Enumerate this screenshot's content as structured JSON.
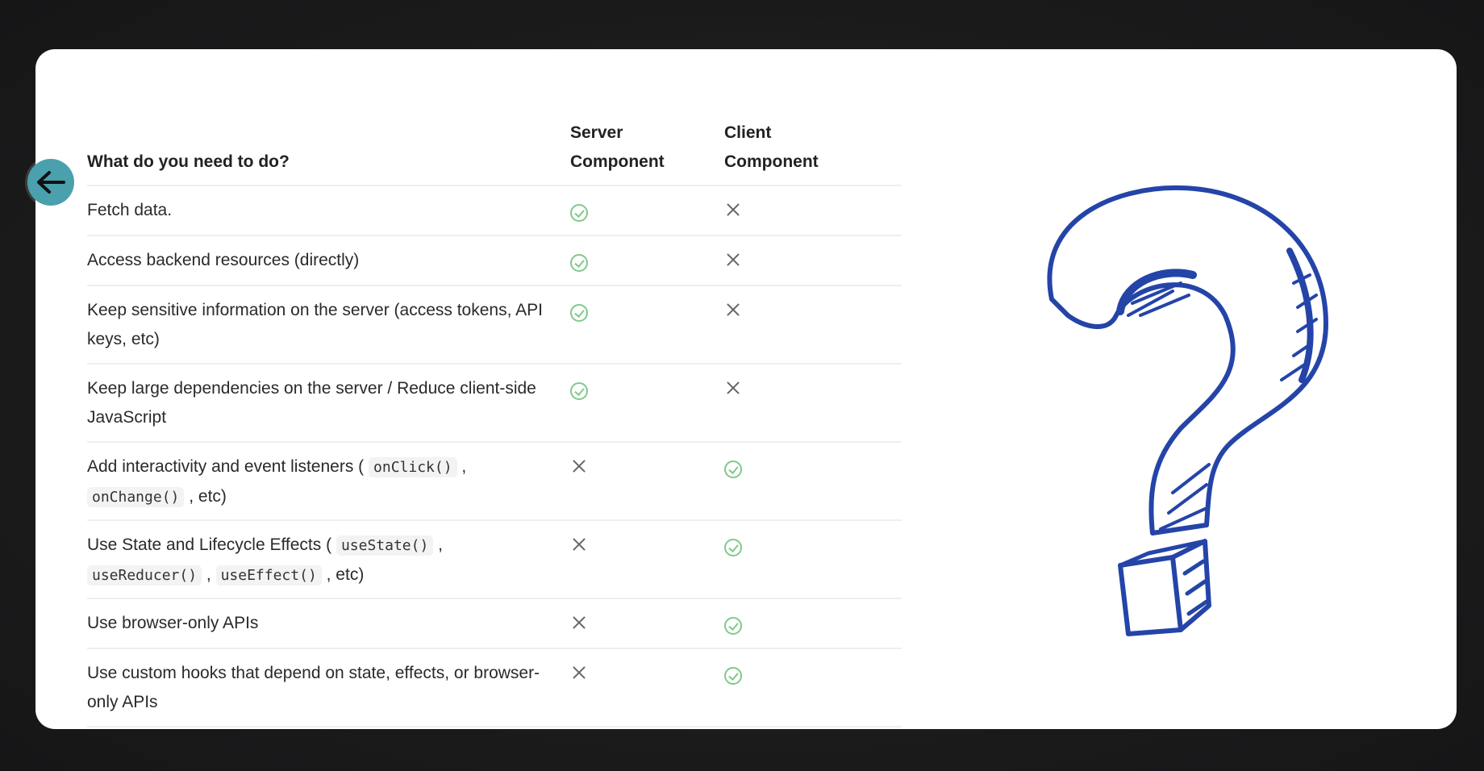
{
  "table": {
    "headers": {
      "task": "What do you need to do?",
      "server_line1": "Server",
      "server_line2": "Component",
      "client_line1": "Client",
      "client_line2": "Component"
    },
    "rows": [
      {
        "text": "Fetch data.",
        "server": "check",
        "client": "cross"
      },
      {
        "text": "Access backend resources (directly)",
        "server": "check",
        "client": "cross"
      },
      {
        "text": "Keep sensitive information on the server (access tokens, API keys, etc)",
        "server": "check",
        "client": "cross"
      },
      {
        "text": "Keep large dependencies on the server / Reduce client-side JavaScript",
        "server": "check",
        "client": "cross"
      },
      {
        "text_before": "Add interactivity and event listeners (",
        "code1": "onClick()",
        "text_mid": ",",
        "code2": "onChange()",
        "text_after": ", etc)",
        "server": "cross",
        "client": "check"
      },
      {
        "text_before": "Use State and Lifecycle Effects (",
        "code1": "useState()",
        "text_mid": ",",
        "code2": "useReducer()",
        "text_mid2": ",",
        "code3": "useEffect()",
        "text_after": ", etc)",
        "server": "cross",
        "client": "check"
      },
      {
        "text": "Use browser-only APIs",
        "server": "cross",
        "client": "check"
      },
      {
        "text": "Use custom hooks that depend on state, effects, or browser-only APIs",
        "server": "cross",
        "client": "check"
      }
    ]
  },
  "icons": {
    "back": "arrow-left-icon",
    "decoration": "question-mark-icon",
    "check": "check-circle-icon",
    "cross": "cross-icon"
  },
  "colors": {
    "check": "#7fc98b",
    "back_button": "#4aa0ad",
    "question_mark": "#2444a8"
  }
}
